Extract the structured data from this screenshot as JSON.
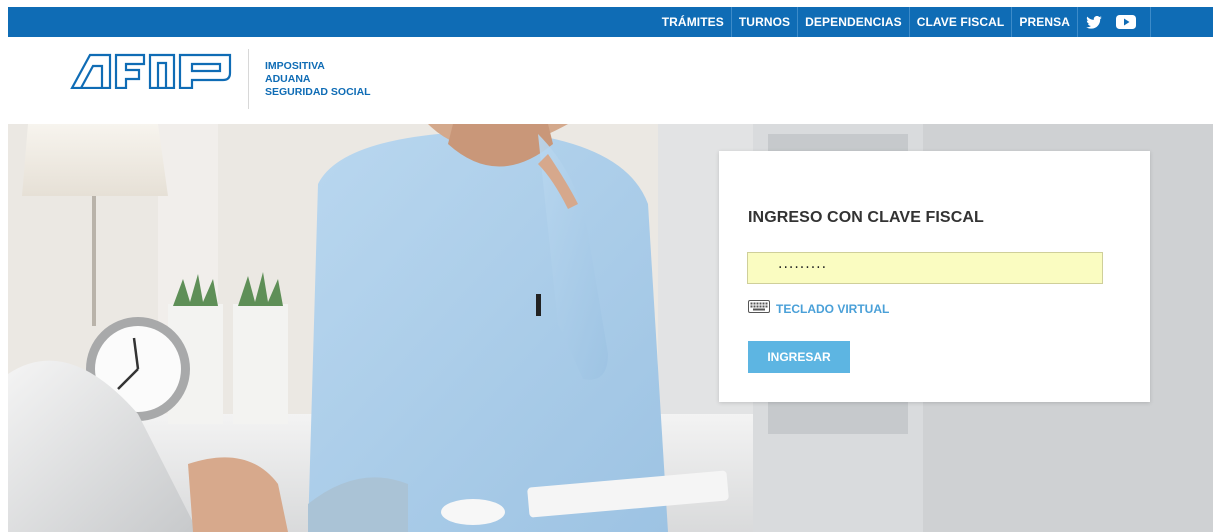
{
  "nav": {
    "items": [
      "TRÁMITES",
      "TURNOS",
      "DEPENDENCIAS",
      "CLAVE FISCAL",
      "PRENSA"
    ],
    "social": [
      "twitter-icon",
      "youtube-icon"
    ],
    "bar_color": "#0f6cb5"
  },
  "header": {
    "logo_text": "AFIP",
    "tagline": [
      "IMPOSITIVA",
      "ADUANA",
      "SEGURIDAD SOCIAL"
    ]
  },
  "login": {
    "title": "INGRESO CON CLAVE FISCAL",
    "password_value": "·········",
    "virtual_keyboard_label": "TECLADO VIRTUAL",
    "submit_label": "INGRESAR",
    "field_bg": "#fafcc1",
    "button_color": "#5db5e2"
  }
}
